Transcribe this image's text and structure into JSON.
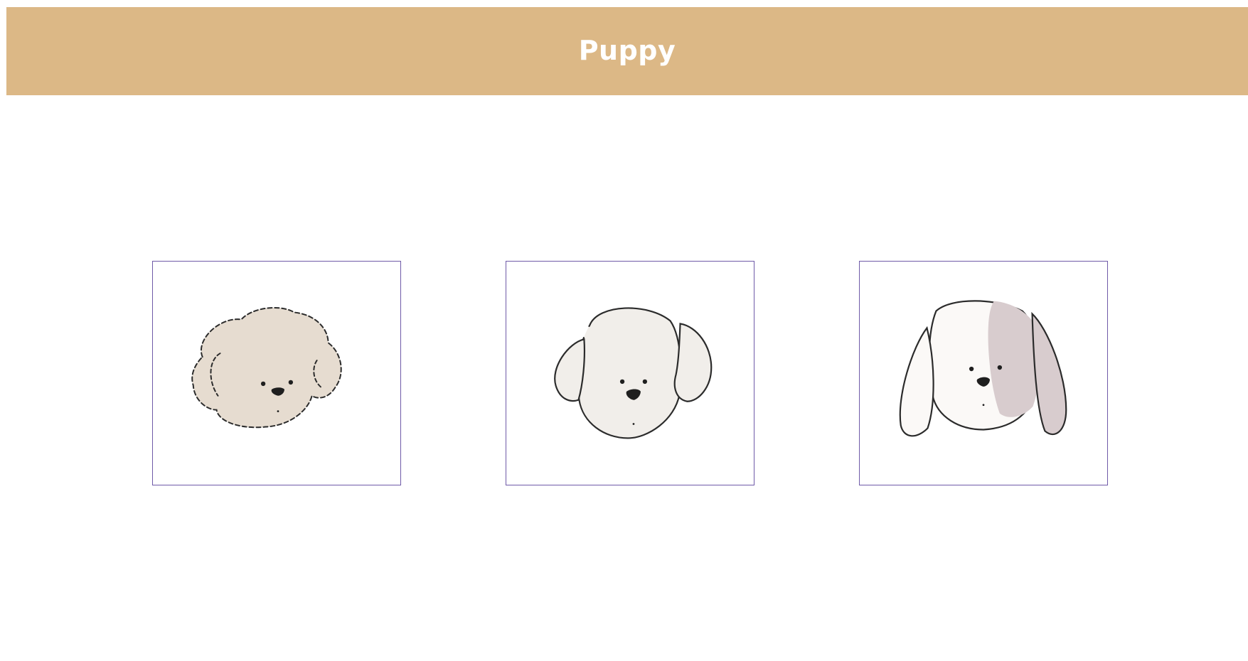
{
  "header": {
    "title": "Puppy",
    "background_color": "#dcb886",
    "text_color": "#ffffff"
  },
  "gallery": {
    "border_color": "#6f5aa8",
    "cards": [
      {
        "icon": "curly-puppy-icon",
        "fill_color": "#e6dcd0"
      },
      {
        "icon": "round-puppy-icon",
        "fill_color": "#f1eeea"
      },
      {
        "icon": "spotted-puppy-icon",
        "fill_color": "#d8ccce"
      }
    ]
  }
}
